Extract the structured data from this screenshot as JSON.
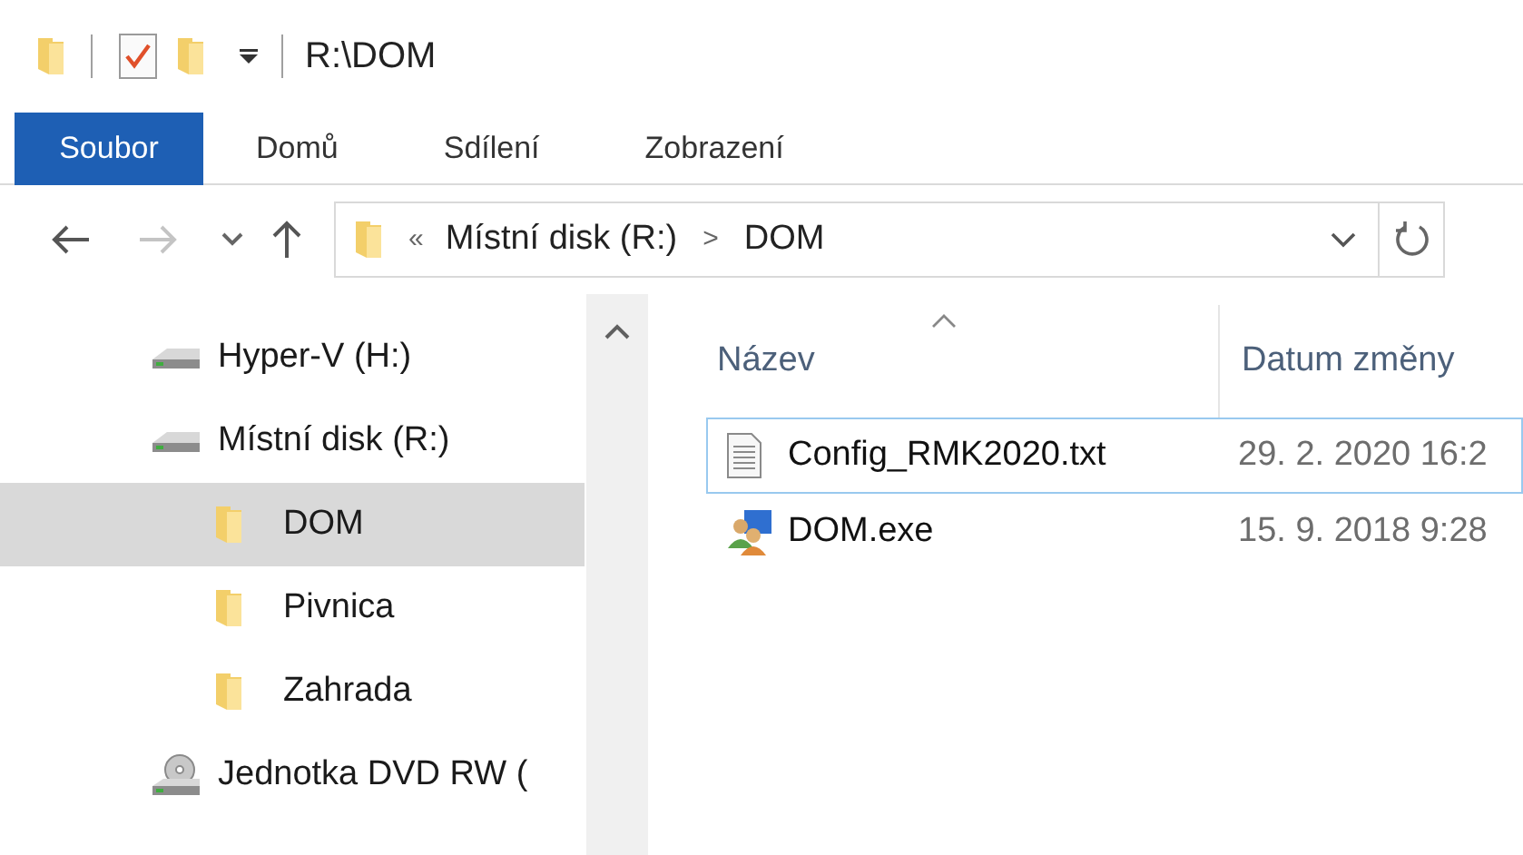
{
  "window": {
    "title": "R:\\DOM"
  },
  "quick_access": [
    {
      "kind": "folder"
    },
    {
      "kind": "properties"
    },
    {
      "kind": "folder"
    }
  ],
  "ribbon_tabs": [
    {
      "label": "Soubor",
      "selected": true
    },
    {
      "label": "Domů",
      "selected": false
    },
    {
      "label": "Sdílení",
      "selected": false
    },
    {
      "label": "Zobrazení",
      "selected": false
    }
  ],
  "address_bar": {
    "overflow": "«",
    "path": [
      {
        "label": "Místní disk (R:)"
      },
      {
        "label": "DOM"
      }
    ],
    "separator": ">"
  },
  "nav_tree": [
    {
      "label": "Hyper-V (H:)",
      "kind": "drive",
      "selected": false
    },
    {
      "label": "Místní disk (R:)",
      "kind": "drive",
      "selected": false,
      "children": [
        {
          "label": "DOM",
          "kind": "folder",
          "selected": true
        },
        {
          "label": "Pivnica",
          "kind": "folder",
          "selected": false
        },
        {
          "label": "Zahrada",
          "kind": "folder",
          "selected": false
        }
      ]
    },
    {
      "label": "Jednotka DVD RW (",
      "kind": "dvd",
      "selected": false
    }
  ],
  "file_list": {
    "columns": [
      {
        "label": "Název",
        "sorted": true
      },
      {
        "label": "Datum změny",
        "sorted": false
      }
    ],
    "rows": [
      {
        "name": "Config_RMK2020.txt",
        "kind": "text",
        "date": "29. 2. 2020 16:2",
        "focused": true
      },
      {
        "name": "DOM.exe",
        "kind": "exe",
        "date": "15. 9. 2018 9:28",
        "focused": false
      }
    ]
  }
}
